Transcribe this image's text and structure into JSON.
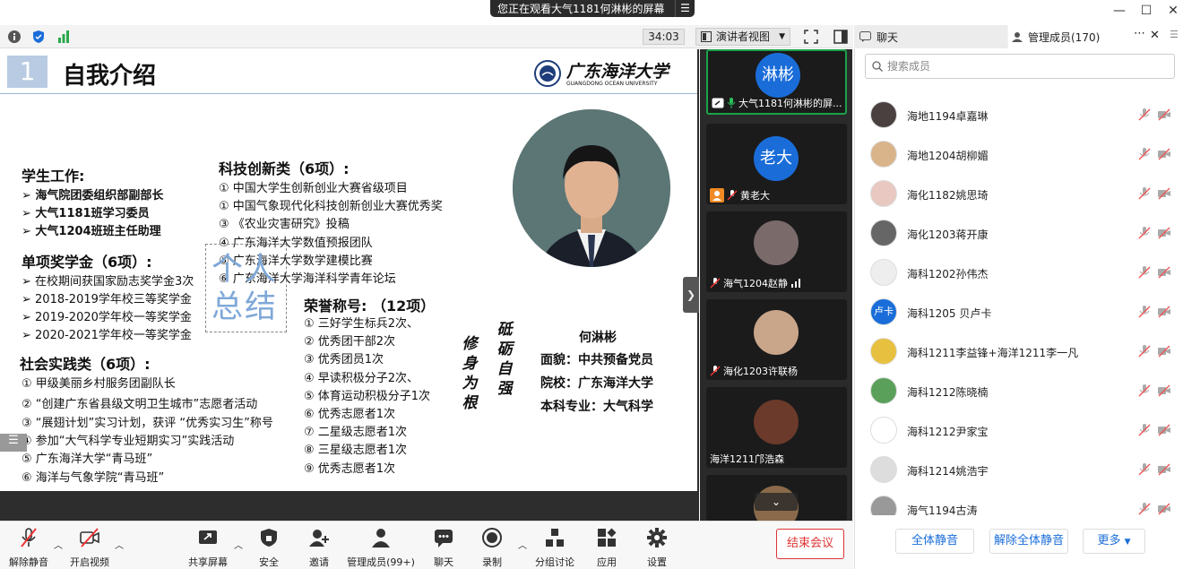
{
  "share_banner": {
    "text": "您正在观看大气1181何淋彬的屏幕"
  },
  "topbar": {
    "timer": "34:03",
    "view_label": "演讲者视图"
  },
  "slide": {
    "number": "1",
    "title": "自我介绍",
    "logo_cn": "广东海洋大学",
    "logo_en": "GUANGDONG OCEAN UNIVERSITY",
    "student_work": {
      "heading": "学生工作:",
      "items": [
        "海气院团委组织部副部长",
        "大气1181班学习委员",
        "大气1204班班主任助理"
      ]
    },
    "scholarship": {
      "heading": "单项奖学金（6项）:",
      "items": [
        "在校期间获国家励志奖学金3次",
        "2018-2019学年校三等奖学金",
        "2019-2020学年校一等奖学金",
        "2020-2021学年校一等奖学金"
      ]
    },
    "social": {
      "heading": "社会实践类（6项）:",
      "items": [
        "① 甲级美丽乡村服务团副队长",
        "② “创建广东省县级文明卫生城市”志愿者活动",
        "③ “展翅计划”实习计划，获评 “优秀实习生”称号",
        "④ 参加“大气科学专业短期实习”实践活动",
        "⑤ 广东海洋大学“青马班”",
        "⑥ 海洋与气象学院“青马班”"
      ]
    },
    "tech": {
      "heading": "科技创新类（6项）:",
      "items": [
        "① 中国大学生创新创业大赛省级项目",
        "① 中国气象现代化科技创新创业大赛优秀奖",
        "③ 《农业灾害研究》投稿",
        "④ 广东海洋大学数值预报团队",
        "⑤ 广东海洋大学数学建模比赛",
        "⑥ 广东海洋大学海洋科学青年论坛"
      ]
    },
    "summary": [
      "个人",
      "总结"
    ],
    "honors": {
      "heading": "荣誉称号: （12项）",
      "items": [
        "① 三好学生标兵2次、",
        "② 优秀团干部2次",
        "③ 优秀团员1次",
        "④ 早读积极分子2次、",
        "⑤ 体育运动积极分子1次",
        "⑥ 优秀志愿者1次",
        "⑦ 二星级志愿者1次",
        "⑧ 三星级志愿者1次",
        "⑨ 优秀志愿者1次"
      ]
    },
    "motto_left": [
      "修",
      "身",
      "为",
      "根"
    ],
    "motto_right": [
      "砥",
      "砺",
      "自",
      "强"
    ],
    "person": {
      "name": "何淋彬",
      "lines": [
        "面貌：中共预备党员",
        "院校：广东海洋大学",
        "本科专业：大气科学"
      ]
    }
  },
  "gallery": [
    {
      "avatar_text": "淋彬",
      "name": "大气1181何淋彬的屏...",
      "color": "#1a6dd9"
    },
    {
      "avatar_text": "老大",
      "name": "黄老大",
      "color": "#1a6dd9"
    },
    {
      "avatar_text": "",
      "name": "海气1204赵静",
      "color": "#7a6a6a"
    },
    {
      "avatar_text": "",
      "name": "海化1203许联杨",
      "color": "#c9a58a"
    },
    {
      "avatar_text": "",
      "name": "海洋1211邝浩森",
      "color": "#6b3a2a"
    },
    {
      "avatar_text": "",
      "name": "",
      "color": "#8a6a4a"
    }
  ],
  "right_panel": {
    "tab_chat": "聊天",
    "tab_members": "管理成员(170)",
    "search_placeholder": "搜索成员",
    "members": [
      {
        "name": "海地1194卓嘉琳",
        "avatar_text": "",
        "color": "#4a4040"
      },
      {
        "name": "海地1204胡柳媚",
        "avatar_text": "",
        "color": "#d9b48a"
      },
      {
        "name": "海化1182姚思琦",
        "avatar_text": "",
        "color": "#e8c8c0"
      },
      {
        "name": "海化1203蒋开康",
        "avatar_text": "",
        "color": "#666"
      },
      {
        "name": "海科1202孙伟杰",
        "avatar_text": "",
        "color": "#eee"
      },
      {
        "name": "海科1205 贝卢卡",
        "avatar_text": "卢卡",
        "color": "#1a6dd9"
      },
      {
        "name": "海科1211李益锋+海洋1211李一凡",
        "avatar_text": "",
        "color": "#e8c040"
      },
      {
        "name": "海科1212陈晓楠",
        "avatar_text": "",
        "color": "#5aa05a"
      },
      {
        "name": "海科1212尹家宝",
        "avatar_text": "",
        "color": "#fff"
      },
      {
        "name": "海科1214姚浩宇",
        "avatar_text": "",
        "color": "#ddd"
      },
      {
        "name": "海气1194古涛",
        "avatar_text": "",
        "color": "#999"
      }
    ],
    "btn_mute_all": "全体静音",
    "btn_unmute_all": "解除全体静音",
    "btn_more": "更多"
  },
  "toolbar": {
    "unmute": "解除静音",
    "start_video": "开启视频",
    "share": "共享屏幕",
    "security": "安全",
    "invite": "邀请",
    "members": "管理成员(99+)",
    "chat": "聊天",
    "record": "录制",
    "breakout": "分组讨论",
    "apps": "应用",
    "settings": "设置",
    "end": "结束会议"
  }
}
